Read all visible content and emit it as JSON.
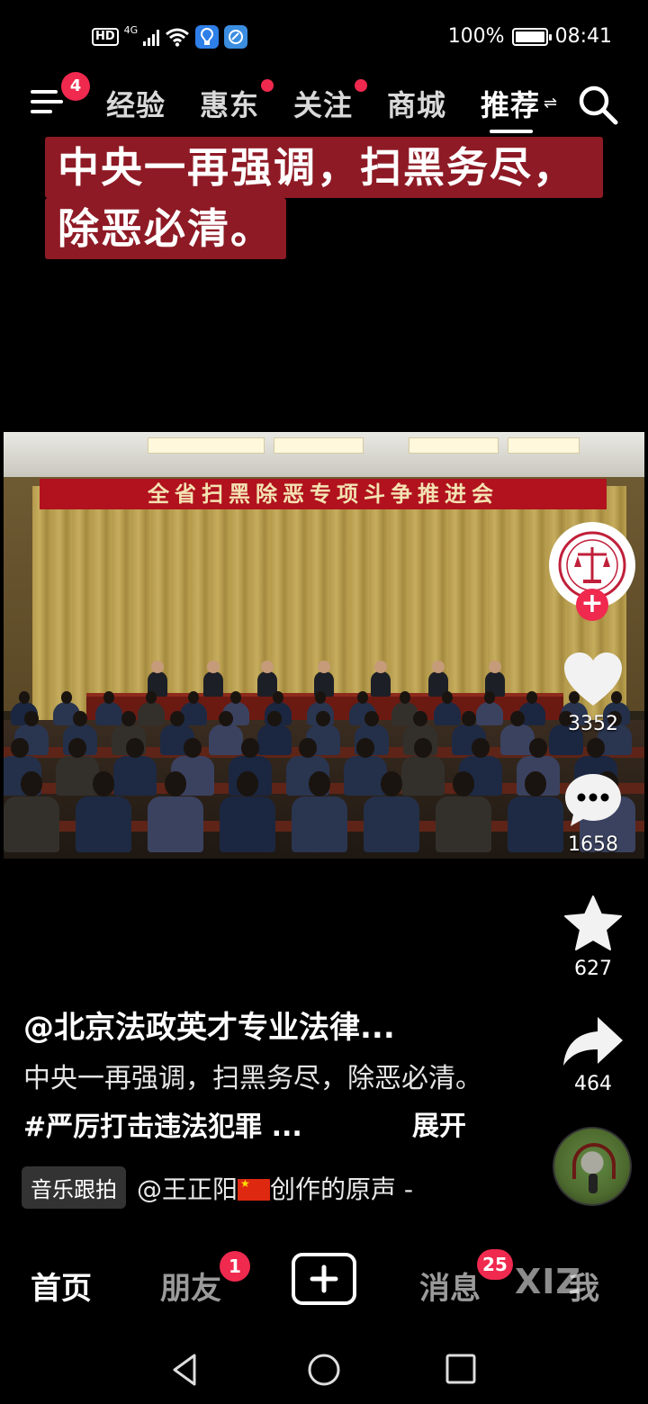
{
  "status_bar": {
    "network_hd": "HD",
    "network_type": "4G",
    "battery_percent": "100%",
    "battery_level": 1.0,
    "time": "08:41"
  },
  "top_nav": {
    "menu_badge": "4",
    "tabs": [
      {
        "label": "经验",
        "dot": false,
        "active": false
      },
      {
        "label": "惠东",
        "dot": true,
        "active": false
      },
      {
        "label": "关注",
        "dot": true,
        "active": false
      },
      {
        "label": "商城",
        "dot": false,
        "active": false
      },
      {
        "label": "推荐",
        "dot": false,
        "active": true
      }
    ],
    "switch_glyph": "⇌",
    "icons": {
      "menu": "hamburger-icon",
      "search": "search-icon"
    }
  },
  "video": {
    "caption_line1": "中央一再强调，扫黑务尽，",
    "caption_line2": "除恶必清。",
    "banner_text": "全省扫黑除恶专项斗争推进会"
  },
  "actions": {
    "like_count": "3352",
    "comment_count": "1658",
    "favorite_count": "627",
    "share_count": "464"
  },
  "post": {
    "author": "@北京法政英才专业法律...",
    "description_text": "中央一再强调，扫黑务尽，除恶必清。",
    "hashtag": "#严厉打击违法犯罪 ...",
    "expand_label": "展开",
    "music_tag": "音乐跟拍",
    "music_prefix": "@王正阳",
    "music_suffix": "创作的原声 -"
  },
  "tab_bar": {
    "home": "首页",
    "friends": "朋友",
    "friends_badge": "1",
    "messages": "消息",
    "messages_badge": "25",
    "me": "我",
    "watermark": "XIZ"
  },
  "colors": {
    "accent": "#f0294f",
    "caption_bg": "#8e1a25",
    "banner_bg": "#b1121e"
  }
}
